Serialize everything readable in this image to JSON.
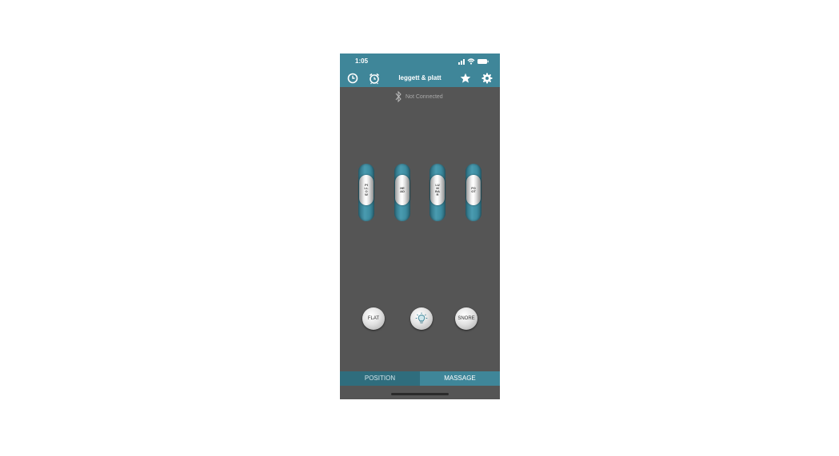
{
  "status_bar": {
    "time": "1:05"
  },
  "nav": {
    "title": "leggett & platt"
  },
  "connection": {
    "status": "Not Connected"
  },
  "sliders": [
    {
      "label": "PILLOW"
    },
    {
      "label": "HEAD"
    },
    {
      "label": "LUMBAR"
    },
    {
      "label": "FOOT"
    }
  ],
  "buttons": {
    "flat": "FLAT",
    "snore": "SNORE"
  },
  "tabs": [
    {
      "label": "POSITION"
    },
    {
      "label": "MASSAGE"
    }
  ],
  "colors": {
    "accent": "#3f8699",
    "background": "#555555",
    "tab_inactive": "#2f6d7d"
  }
}
